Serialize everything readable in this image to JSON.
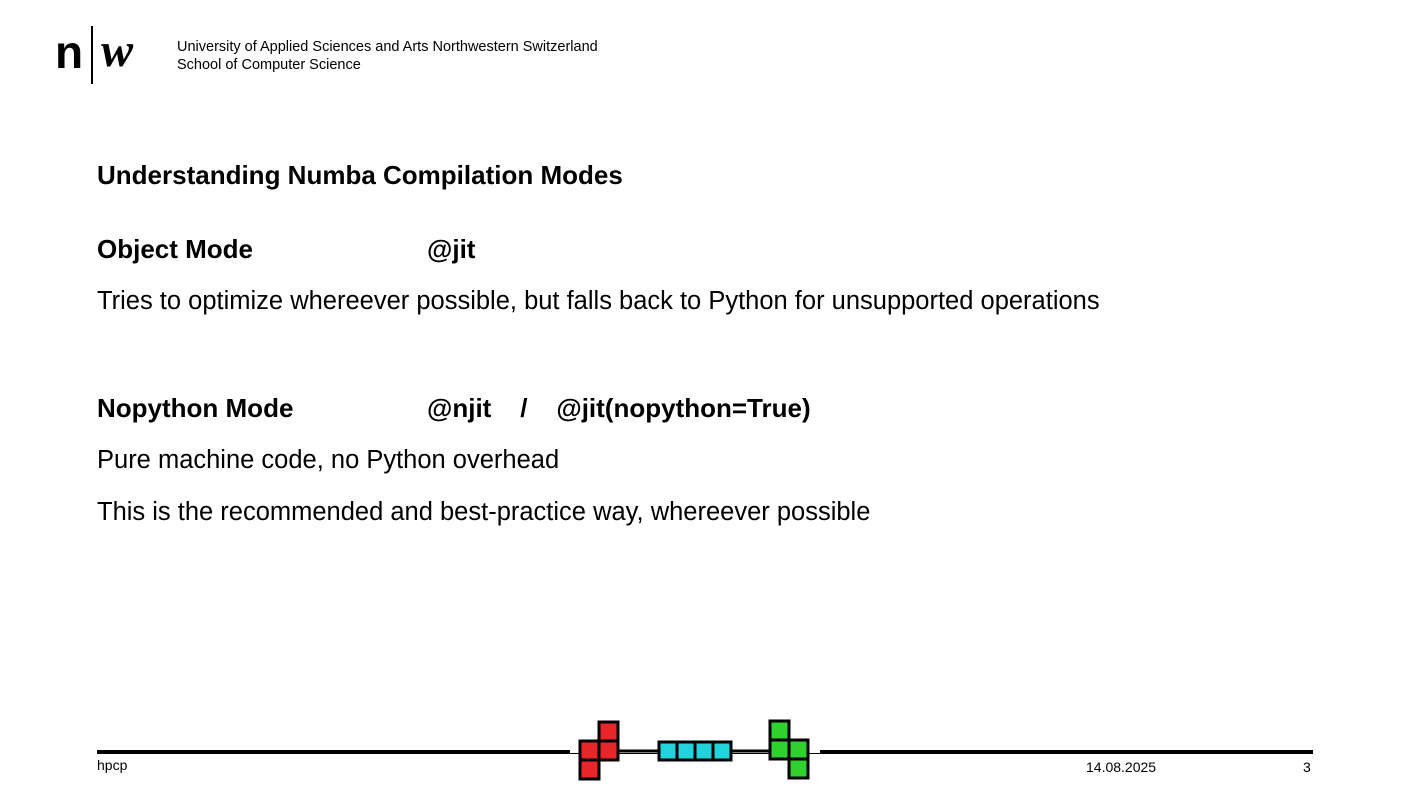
{
  "header": {
    "logo_n": "n",
    "logo_w": "w",
    "institution_line1": "University of Applied Sciences and Arts Northwestern Switzerland",
    "institution_line2": "School of Computer Science"
  },
  "slide": {
    "title": "Understanding Numba Compilation Modes",
    "object_mode": {
      "name": "Object Mode",
      "decorator": "@jit",
      "description": "Tries to optimize whereever possible, but falls back to Python for unsupported operations"
    },
    "nopython_mode": {
      "name": "Nopython Mode",
      "decorator": "@njit    /    @jit(nopython=True)",
      "description1": "Pure machine code, no Python overhead",
      "description2": "This is the recommended and best-practice way, whereever possible"
    }
  },
  "footer": {
    "left": "hpcp",
    "date": "14.08.2025",
    "page": "3"
  },
  "colors": {
    "red_block": "#e8262a",
    "cyan_block": "#22d3dd",
    "green_block": "#2fd12f"
  }
}
